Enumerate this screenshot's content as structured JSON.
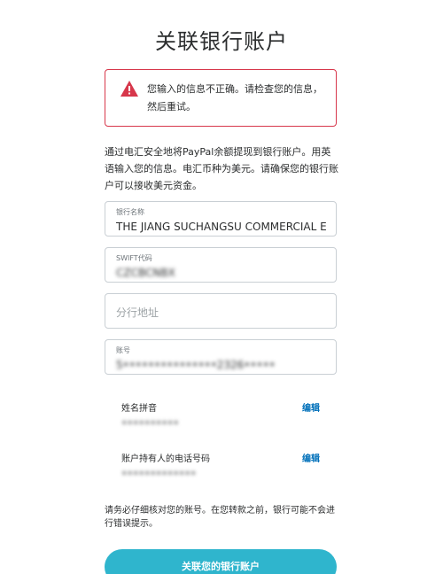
{
  "page": {
    "title": "关联银行账户"
  },
  "alert": {
    "message": "您输入的信息不正确。请检查您的信息，然后重试。",
    "icon": "warning-triangle-icon",
    "border_color": "#d7374b"
  },
  "intro": {
    "text": "通过电汇安全地将PayPal余额提现到银行账户。用英语输入您的信息。电汇币种为美元。请确保您的银行账户可以接收美元资金。"
  },
  "fields": {
    "bank_name": {
      "label": "银行名称",
      "value": "THE JIANG SUCHANGSU COMMERCIAL E"
    },
    "swift": {
      "label": "SWIFT代码",
      "value": "CZCBCNBX"
    },
    "branch_address": {
      "placeholder": "分行地址"
    },
    "account_number": {
      "label": "账号",
      "value": "5•••••••••••••••2326•••••"
    }
  },
  "info": {
    "name_pinyin": {
      "label": "姓名拼音",
      "value": "••••••••••",
      "edit_label": "编辑"
    },
    "holder_phone": {
      "label": "账户持有人的电话号码",
      "value": "•••••••••••••",
      "edit_label": "编辑"
    }
  },
  "note": {
    "text": "请务必仔细核对您的账号。在您转款之前，银行可能不会进行错误提示。"
  },
  "submit": {
    "label": "关联您的银行账户",
    "color": "#2fb5cd"
  }
}
